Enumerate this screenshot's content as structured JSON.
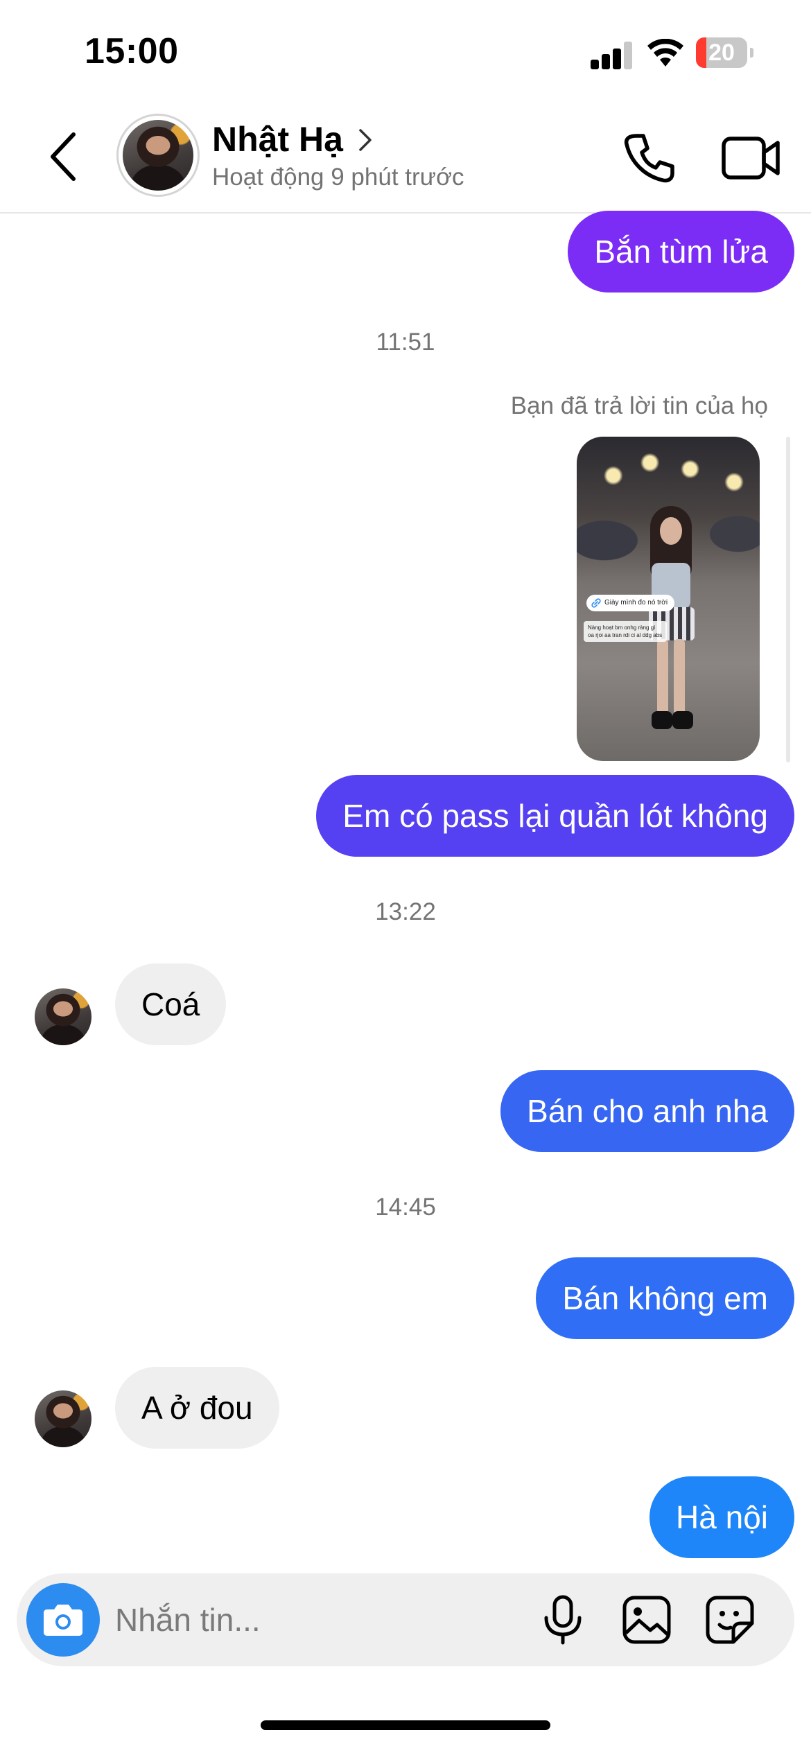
{
  "status_bar": {
    "time": "15:00",
    "battery": "20",
    "battery_level": 0.2
  },
  "header": {
    "contact_name": "Nhật Hạ",
    "contact_status": "Hoạt động 9 phút trước",
    "icons": {
      "back": "chevron-left-icon",
      "name_chevron": "chevron-right-icon",
      "call": "phone-icon",
      "video": "video-camera-icon"
    }
  },
  "messages": {
    "m1": "Bắn tùm lửa",
    "t1": "11:51",
    "reply_note": "Bạn đã trả lời tin của họ",
    "story": {
      "sticker": "Giày mình đo nó trời",
      "caption": "Nàng hoạt bm onhg ràng gì oa rjoi aa tran rdi ci al ddg abs"
    },
    "m2": "Em có pass lại quần lót không",
    "t2": "13:22",
    "m3": "Coá",
    "m4": "Bán cho anh nha",
    "t3": "14:45",
    "m5": "Bán không em",
    "m6": "A ở đou",
    "m7": "Hà nội"
  },
  "bubble_colors": {
    "m1": "#7B2CF5",
    "m2": "#5540F2",
    "m4": "#3766F2",
    "m5": "#2F6EF5",
    "m7": "#1E86F8",
    "incoming": "#EFEFEF"
  },
  "composer": {
    "placeholder": "Nhắn tin...",
    "icons": {
      "camera": "camera-icon",
      "mic": "microphone-icon",
      "gallery": "image-icon",
      "sticker": "sticker-icon"
    }
  }
}
